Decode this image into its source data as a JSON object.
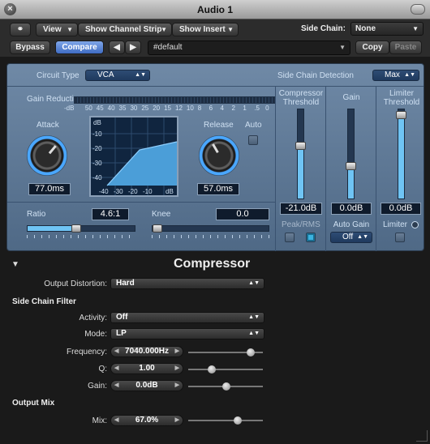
{
  "window": {
    "title": "Audio 1"
  },
  "toolbar": {
    "view_label": "View",
    "channel_strip_label": "Show Channel Strip",
    "insert_label": "Show Insert",
    "side_chain_label": "Side Chain:",
    "side_chain_value": "None",
    "bypass_label": "Bypass",
    "compare_label": "Compare",
    "prev_symbol": "◀",
    "next_symbol": "▶",
    "preset_value": "#default",
    "copy_label": "Copy",
    "paste_label": "Paste",
    "link_icon": "link-icon"
  },
  "compressor": {
    "circuit_type_label": "Circuit Type",
    "circuit_type_value": "VCA",
    "sc_detection_label": "Side Chain Detection",
    "sc_detection_value": "Max",
    "gain_reduction_label": "Gain Reduction",
    "gain_reduction_scale": [
      "-dB",
      "50",
      "45",
      "40",
      "35",
      "30",
      "25",
      "20",
      "15",
      "12",
      "10",
      "8",
      "6",
      "4",
      "2",
      "1",
      ".5",
      "0"
    ],
    "attack_label": "Attack",
    "attack_value": "77.0ms",
    "release_label": "Release",
    "release_value": "57.0ms",
    "auto_label": "Auto",
    "graph": {
      "unit": "dB",
      "y_ticks": [
        "-10",
        "-20",
        "-30",
        "-40"
      ],
      "x_ticks": [
        "-40",
        "-30",
        "-20",
        "-10"
      ],
      "x_unit": "dB"
    },
    "ratio_label": "Ratio",
    "ratio_value": "4.6:1",
    "knee_label": "Knee",
    "knee_value": "0.0",
    "threshold_label": "Compressor Threshold",
    "threshold_value": "-21.0dB",
    "gain_label": "Gain",
    "gain_value": "0.0dB",
    "limiter_threshold_label": "Limiter Threshold",
    "limiter_threshold_value": "0.0dB",
    "peak_label": "Peak",
    "rms_label": "/RMS",
    "auto_gain_label": "Auto Gain",
    "auto_gain_value": "Off",
    "limiter_label": "Limiter"
  },
  "extended": {
    "section_title": "Compressor",
    "output_distortion_label": "Output Distortion:",
    "output_distortion_value": "Hard",
    "side_chain_filter_label": "Side Chain Filter",
    "activity_label": "Activity:",
    "activity_value": "Off",
    "mode_label": "Mode:",
    "mode_value": "LP",
    "frequency_label": "Frequency:",
    "frequency_value": "7040.000Hz",
    "q_label": "Q:",
    "q_value": "1.00",
    "gain_label": "Gain:",
    "gain_value": "0.0dB",
    "output_mix_label": "Output Mix",
    "mix_label": "Mix:",
    "mix_value": "67.0%"
  }
}
